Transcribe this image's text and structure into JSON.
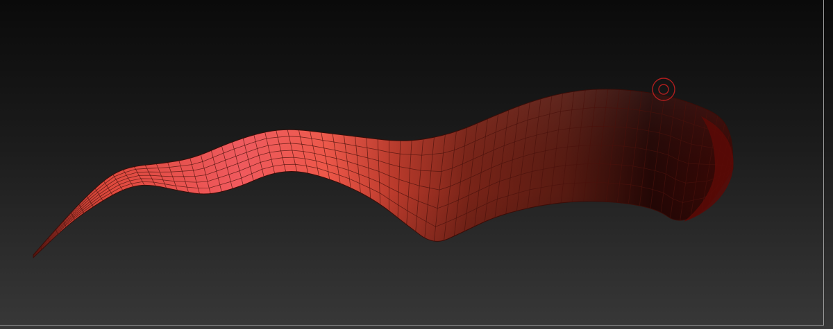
{
  "viewport": {
    "name": "3D viewport",
    "background_top": "#0a0a0a",
    "background_bottom": "#383838",
    "frame_color": "#9a9a9a"
  },
  "model": {
    "kind": "polygon mesh strip",
    "base_color_light": "#f25a55",
    "base_color_mid": "#c5412f",
    "base_color_dark": "#1f0604",
    "wire_color": "#4a120c"
  },
  "cursor": {
    "icon": "brush-cursor-icon",
    "color": "#b01e1e"
  }
}
